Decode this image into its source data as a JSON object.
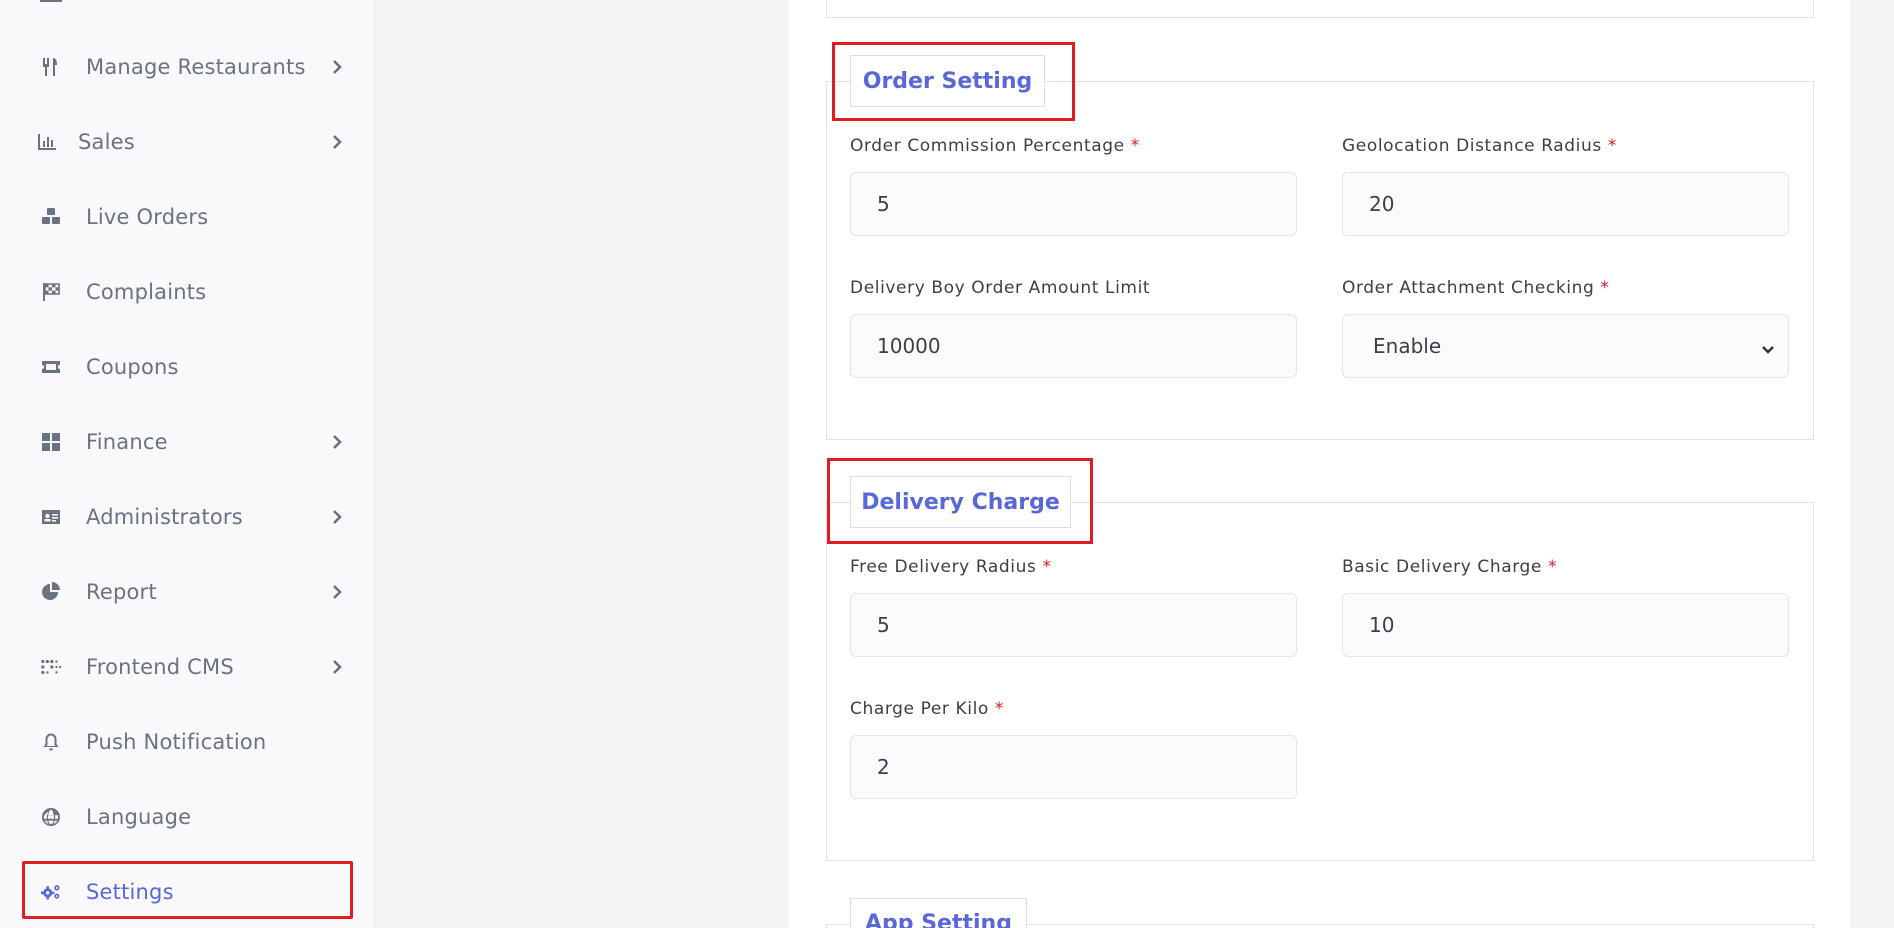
{
  "sidebar": {
    "items": [
      {
        "label": "Manage Restaurants",
        "icon": "utensils-icon",
        "has_children": true
      },
      {
        "label": "Sales",
        "icon": "bar-chart-icon",
        "has_children": true
      },
      {
        "label": "Live Orders",
        "icon": "cubes-icon",
        "has_children": false
      },
      {
        "label": "Complaints",
        "icon": "flag-checkered-icon",
        "has_children": false
      },
      {
        "label": "Coupons",
        "icon": "ticket-icon",
        "has_children": false
      },
      {
        "label": "Finance",
        "icon": "grid-icon",
        "has_children": true
      },
      {
        "label": "Administrators",
        "icon": "id-card-icon",
        "has_children": true
      },
      {
        "label": "Report",
        "icon": "pie-chart-icon",
        "has_children": true
      },
      {
        "label": "Frontend CMS",
        "icon": "braille-icon",
        "has_children": true
      },
      {
        "label": "Push Notification",
        "icon": "bell-icon",
        "has_children": false
      },
      {
        "label": "Language",
        "icon": "globe-icon",
        "has_children": false
      },
      {
        "label": "Settings",
        "icon": "cogs-icon",
        "has_children": false,
        "active": true
      }
    ]
  },
  "order_setting": {
    "legend": "Order Setting",
    "commission_label": "Order Commission Percentage",
    "commission_value": "5",
    "geo_radius_label": "Geolocation Distance Radius",
    "geo_radius_value": "20",
    "delivery_limit_label": "Delivery Boy Order Amount Limit",
    "delivery_limit_value": "10000",
    "attachment_label": "Order Attachment Checking",
    "attachment_value": "Enable"
  },
  "delivery_charge": {
    "legend": "Delivery Charge",
    "free_radius_label": "Free Delivery Radius",
    "free_radius_value": "5",
    "basic_charge_label": "Basic Delivery Charge",
    "basic_charge_value": "10",
    "per_kilo_label": "Charge Per Kilo",
    "per_kilo_value": "2"
  },
  "app_setting": {
    "legend": "App Setting"
  },
  "required_mark": "*",
  "colors": {
    "accent": "#5a67d8",
    "highlight": "#e31b23",
    "muted": "#6b7280"
  }
}
